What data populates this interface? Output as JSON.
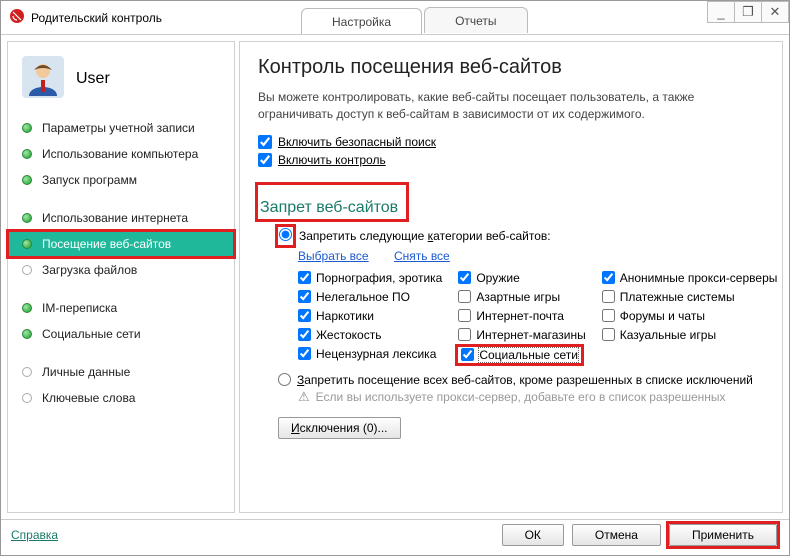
{
  "window": {
    "title": "Родительский контроль",
    "minimize": "_",
    "restore": "❐",
    "close": "✕"
  },
  "tabs": {
    "settings": "Настройка",
    "reports": "Отчеты"
  },
  "user": {
    "name": "User"
  },
  "sidebar": {
    "items": [
      {
        "label": "Параметры учетной записи",
        "on": true
      },
      {
        "label": "Использование компьютера",
        "on": true
      },
      {
        "label": "Запуск программ",
        "on": true
      },
      {
        "label": "Использование интернета",
        "on": true
      },
      {
        "label": "Посещение веб-сайтов",
        "on": true,
        "active": true
      },
      {
        "label": "Загрузка файлов",
        "on": false
      },
      {
        "label": "IM-переписка",
        "on": true
      },
      {
        "label": "Социальные сети",
        "on": true
      },
      {
        "label": "Личные данные",
        "on": false
      },
      {
        "label": "Ключевые слова",
        "on": false
      }
    ]
  },
  "content": {
    "heading": "Контроль посещения веб-сайтов",
    "desc": "Вы можете контролировать, какие веб-сайты посещает пользователь, а также ограничивать доступ к веб-сайтам в зависимости от их содержимого.",
    "checks": {
      "safe_pre": "Включить ",
      "safe_u": "б",
      "safe_post": "езопасный поиск",
      "ctrl_pre": "Включить к",
      "ctrl_u": "о",
      "ctrl_post": "нтроль"
    },
    "section": "Запрет веб-сайтов",
    "radio1_pre": "Запретить следующие ",
    "radio1_u": "к",
    "radio1_post": "атегории веб-сайтов:",
    "links": {
      "select_u": "В",
      "select_post": "ыбрать все",
      "clear_u": "С",
      "clear_post": "нять все"
    },
    "categories": {
      "col1": [
        {
          "label": "Порнография, эротика",
          "checked": true
        },
        {
          "label": "Нелегальное ПО",
          "checked": true
        },
        {
          "label": "Наркотики",
          "checked": true
        },
        {
          "label": "Жестокость",
          "checked": true
        },
        {
          "label": "Нецензурная лексика",
          "checked": true
        }
      ],
      "col2": [
        {
          "label": "Оружие",
          "checked": true
        },
        {
          "label": "Азартные игры",
          "checked": false
        },
        {
          "label": "Интернет-почта",
          "checked": false
        },
        {
          "label": "Интернет-магазины",
          "checked": false
        },
        {
          "label": "Социальные сети",
          "checked": true,
          "highlight": true
        }
      ],
      "col3": [
        {
          "label": "Анонимные прокси-серверы",
          "checked": true
        },
        {
          "label": "Платежные системы",
          "checked": false
        },
        {
          "label": "Форумы и чаты",
          "checked": false
        },
        {
          "label": "Казуальные игры",
          "checked": false
        }
      ]
    },
    "radio2_pre": "",
    "radio2_u": "З",
    "radio2_post": "апретить посещение всех веб-сайтов, кроме разрешенных в списке исключений",
    "hint": "Если вы используете прокси-сервер, добавьте его в список разрешенных",
    "excl_u": "И",
    "excl_post": "сключения (0)..."
  },
  "footer": {
    "help": "Справка",
    "ok": "ОК",
    "cancel": "Отмена",
    "apply": "Применить"
  }
}
